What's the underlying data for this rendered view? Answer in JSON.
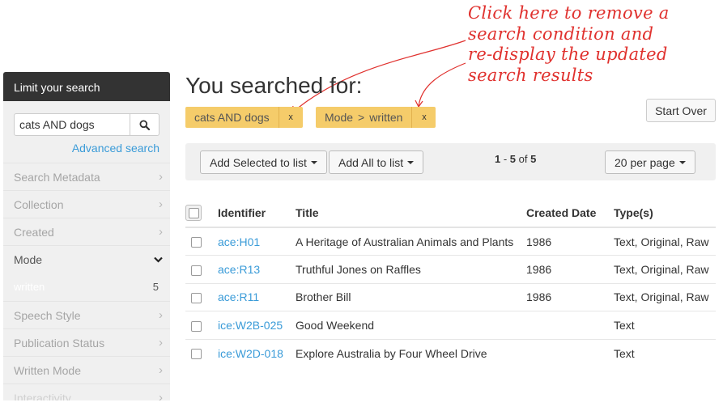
{
  "annotation": {
    "lines": [
      "Click here to remove a",
      "search condition and",
      "re-display the updated",
      "search results"
    ]
  },
  "sidebar": {
    "header": "Limit your search",
    "search_value": "cats AND dogs",
    "search_icon": "magnifier",
    "advanced_link": "Advanced search",
    "facets": [
      {
        "label": "Search Metadata",
        "icon": "chevron-right"
      },
      {
        "label": "Collection",
        "icon": "chevron-right"
      },
      {
        "label": "Created",
        "icon": "chevron-right"
      },
      {
        "label": "Mode",
        "icon": "chevron-down"
      },
      {
        "label": "Speech Style",
        "icon": "chevron-right"
      },
      {
        "label": "Publication Status",
        "icon": "chevron-right"
      },
      {
        "label": "Written Mode",
        "icon": "chevron-right"
      },
      {
        "label": "Interactivity",
        "icon": "chevron-right"
      }
    ],
    "mode_value": {
      "label": "written",
      "count": "5"
    }
  },
  "main": {
    "title": "You searched for:",
    "constraints": [
      {
        "label": "cats AND dogs",
        "remove": "x"
      },
      {
        "label": "Mode",
        "separator": ">",
        "value": "written",
        "remove": "x"
      }
    ],
    "start_over": "Start Over",
    "toolbar": {
      "add_selected": "Add Selected to list",
      "add_all": "Add All to list",
      "range_start": "1",
      "range_sep": " - ",
      "range_end": "5",
      "of": " of ",
      "total": "5",
      "per_page": "20 per page"
    },
    "table": {
      "headers": {
        "identifier": "Identifier",
        "title": "Title",
        "created": "Created Date",
        "types": "Type(s)"
      },
      "rows": [
        {
          "identifier": "ace:H01",
          "title": "A Heritage of Australian Animals and Plants",
          "created": "1986",
          "types": "Text, Original, Raw"
        },
        {
          "identifier": "ace:R13",
          "title": "Truthful Jones on Raffles",
          "created": "1986",
          "types": "Text, Original, Raw"
        },
        {
          "identifier": "ace:R11",
          "title": "Brother Bill",
          "created": "1986",
          "types": "Text, Original, Raw"
        },
        {
          "identifier": "ice:W2B-025",
          "title": "Good Weekend",
          "created": "",
          "types": "Text"
        },
        {
          "identifier": "ice:W2D-018",
          "title": "Explore Australia by Four Wheel Drive",
          "created": "",
          "types": "Text"
        }
      ]
    }
  },
  "colors": {
    "accent_link": "#3a9bd8",
    "chip_bg": "#f5cc6a",
    "annotation": "#e0312e",
    "sidebar_header": "#333333"
  }
}
